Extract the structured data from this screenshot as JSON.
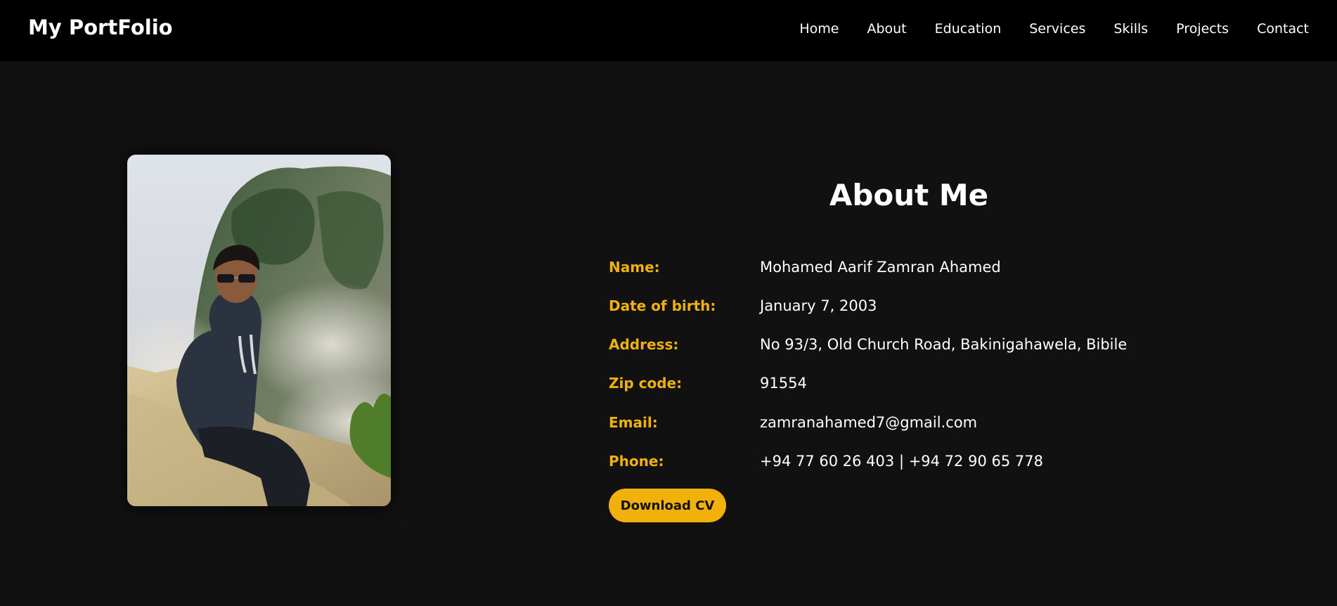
{
  "brand": "My PortFolio",
  "nav": [
    "Home",
    "About",
    "Education",
    "Services",
    "Skills",
    "Projects",
    "Contact"
  ],
  "about": {
    "title": "About Me",
    "rows": [
      {
        "label": "Name:",
        "value": "Mohamed Aarif Zamran Ahamed"
      },
      {
        "label": "Date of birth:",
        "value": "January 7, 2003"
      },
      {
        "label": "Address:",
        "value": "No 93/3, Old Church Road, Bakinigahawela, Bibile"
      },
      {
        "label": "Zip code:",
        "value": "91554"
      },
      {
        "label": "Email:",
        "value": "zamranahamed7@gmail.com"
      },
      {
        "label": "Phone:",
        "value": "+94 77 60 26 403 | +94 72 90 65 778"
      }
    ],
    "cv_button": "Download CV"
  },
  "colors": {
    "accent": "#f2b10a",
    "background": "#111111",
    "navbar": "#000000",
    "text": "#ffffff"
  }
}
